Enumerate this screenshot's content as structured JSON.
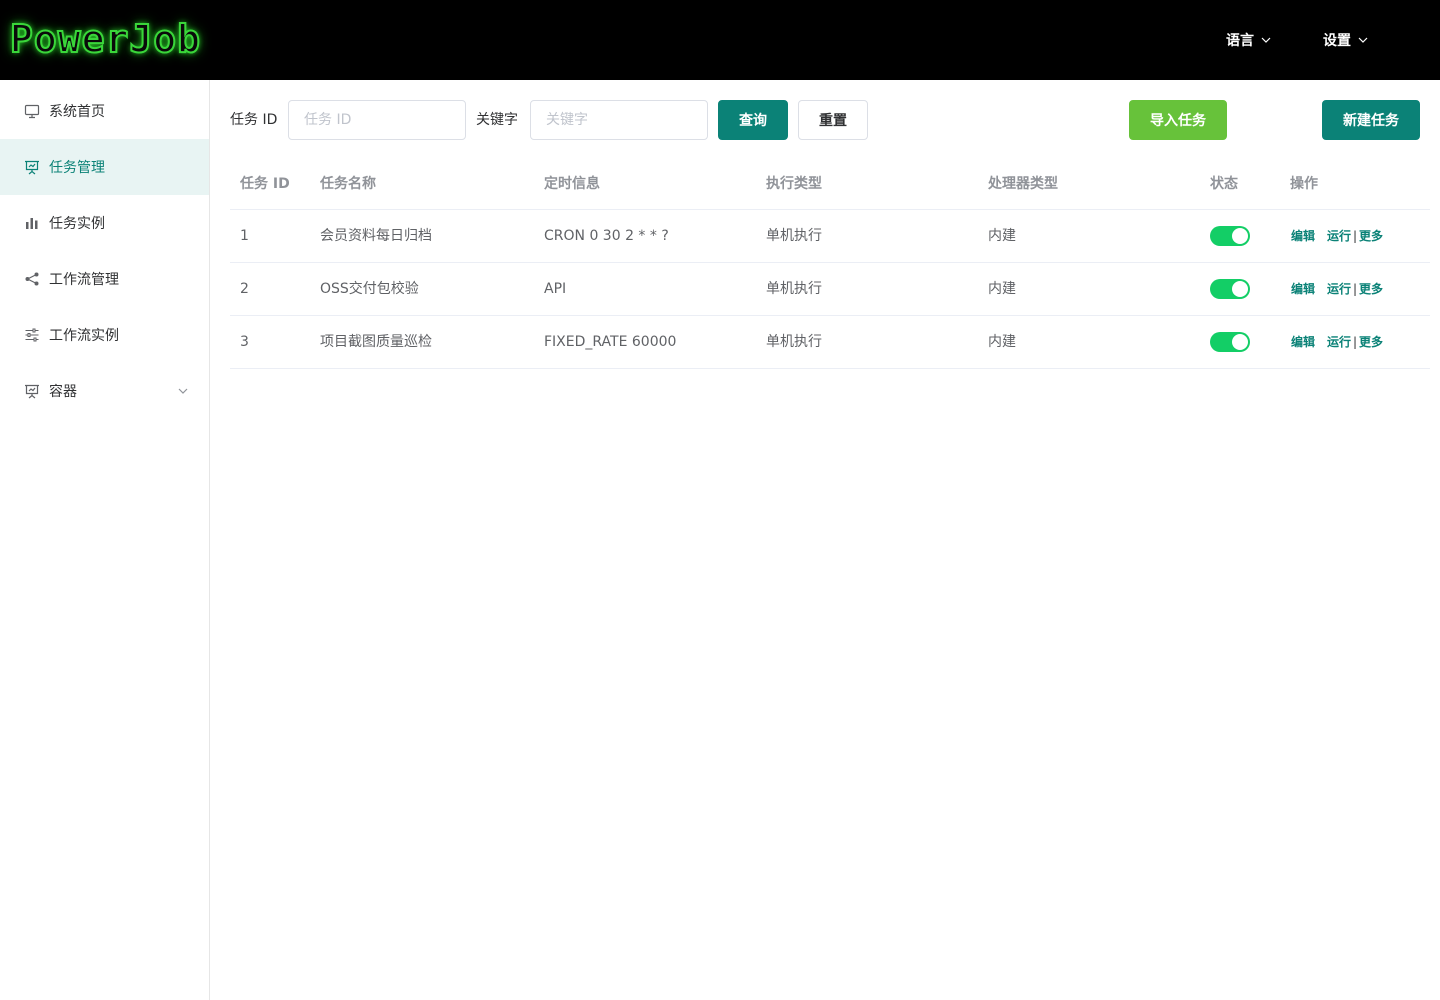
{
  "header": {
    "logo": "PowerJob",
    "language_label": "语言",
    "settings_label": "设置"
  },
  "sidebar": {
    "items": [
      {
        "label": "系统首页",
        "icon": "monitor-icon"
      },
      {
        "label": "任务管理",
        "icon": "presentation-icon",
        "active": true
      },
      {
        "label": "任务实例",
        "icon": "bar-chart-icon"
      },
      {
        "label": "工作流管理",
        "icon": "share-icon"
      },
      {
        "label": "工作流实例",
        "icon": "sliders-icon"
      },
      {
        "label": "容器",
        "icon": "presentation-icon",
        "expandable": true
      }
    ]
  },
  "toolbar": {
    "job_id_label": "任务 ID",
    "job_id_placeholder": "任务 ID",
    "keyword_label": "关键字",
    "keyword_placeholder": "关键字",
    "query_button": "查询",
    "reset_button": "重置",
    "import_button": "导入任务",
    "new_button": "新建任务"
  },
  "table": {
    "columns": [
      "任务 ID",
      "任务名称",
      "定时信息",
      "执行类型",
      "处理器类型",
      "状态",
      "操作"
    ],
    "rows": [
      {
        "id": "1",
        "name": "会员资料每日归档",
        "schedule": "CRON 0 30 2 * * ?",
        "exec_type": "单机执行",
        "processor": "内建",
        "enabled": true
      },
      {
        "id": "2",
        "name": "OSS交付包校验",
        "schedule": "API",
        "exec_type": "单机执行",
        "processor": "内建",
        "enabled": true
      },
      {
        "id": "3",
        "name": "项目截图质量巡检",
        "schedule": "FIXED_RATE 60000",
        "exec_type": "单机执行",
        "processor": "内建",
        "enabled": true
      }
    ],
    "actions": {
      "edit": "编辑",
      "run": "运行",
      "separator": "|",
      "more": "更多"
    }
  },
  "colors": {
    "primary": "#0b8277",
    "success": "#67c23a",
    "switch_on": "#13ce66",
    "header_bg": "#000000"
  }
}
